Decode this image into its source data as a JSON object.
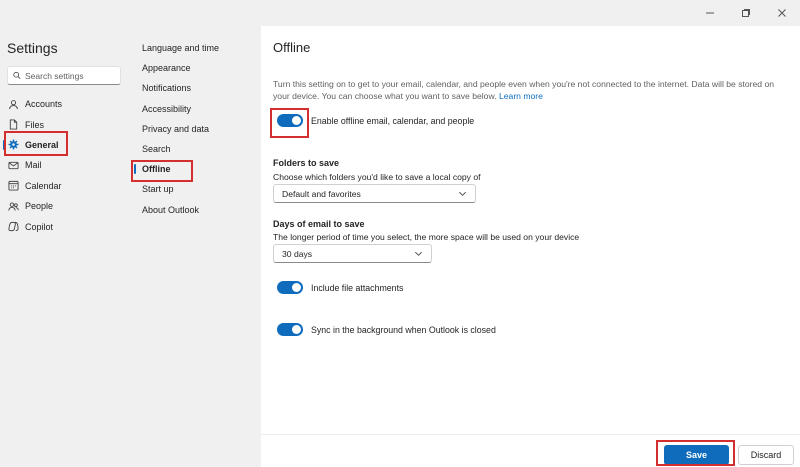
{
  "window": {
    "controls": [
      "minimize-icon",
      "restore-icon",
      "close-icon"
    ]
  },
  "settings": {
    "title": "Settings",
    "search_placeholder": "Search settings",
    "categories": [
      {
        "label": "Accounts",
        "icon": "person-icon"
      },
      {
        "label": "Files",
        "icon": "file-icon"
      },
      {
        "label": "General",
        "icon": "gear-icon",
        "active": true
      },
      {
        "label": "Mail",
        "icon": "mail-icon"
      },
      {
        "label": "Calendar",
        "icon": "calendar-icon"
      },
      {
        "label": "People",
        "icon": "people-icon"
      },
      {
        "label": "Copilot",
        "icon": "copilot-icon"
      }
    ]
  },
  "general_menu": {
    "items": [
      "Language and time",
      "Appearance",
      "Notifications",
      "Accessibility",
      "Privacy and data",
      "Search",
      "Offline",
      "Start up",
      "About Outlook"
    ],
    "active": "Offline"
  },
  "offline": {
    "title": "Offline",
    "description": "Turn this setting on to get to your email, calendar, and people even when you're not connected to the internet. Data will be stored on your device. You can choose what you want to save below.",
    "learn_more": "Learn more",
    "enable_toggle_label": "Enable offline email, calendar, and people",
    "enable_toggle_on": true,
    "folders": {
      "title": "Folders to save",
      "subtitle": "Choose which folders you'd like to save a local copy of",
      "value": "Default and favorites"
    },
    "days": {
      "title": "Days of email to save",
      "subtitle": "The longer period of time you select, the more space will be used on your device",
      "value": "30 days"
    },
    "attachments_toggle_label": "Include file attachments",
    "attachments_toggle_on": true,
    "sync_toggle_label": "Sync in the background when Outlook is closed",
    "sync_toggle_on": true
  },
  "footer": {
    "save_label": "Save",
    "discard_label": "Discard"
  },
  "colors": {
    "accent": "#0f6cbd",
    "highlight": "#d32f2f"
  }
}
